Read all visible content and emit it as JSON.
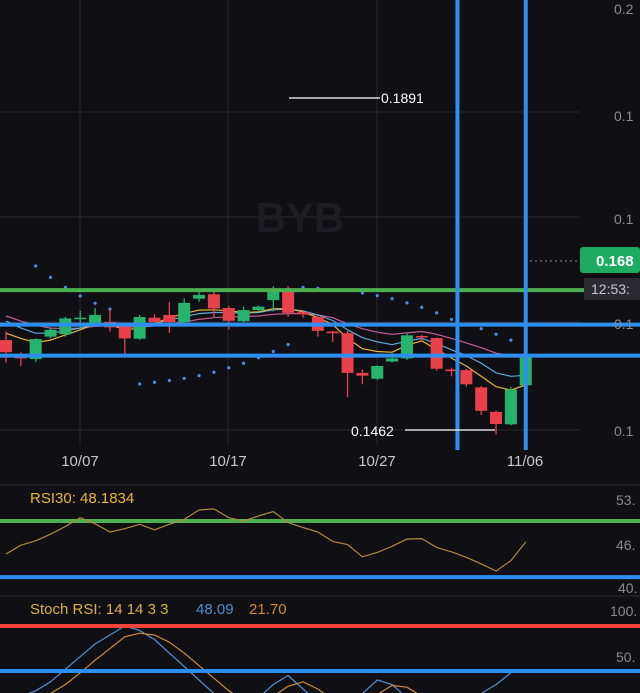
{
  "chart_data": [
    {
      "type": "candlestick",
      "title": "",
      "watermark": "BYB",
      "x_tick_labels": [
        "10/07",
        "10/17",
        "10/27",
        "11/06"
      ],
      "y_tick_labels": [
        "0.2",
        "0.1",
        "0.1",
        "0.1",
        "0.1"
      ],
      "y_range": [
        0.14,
        0.2
      ],
      "price_tag": "0.168",
      "countdown_tag": "12:53:",
      "high_label": "0.1891",
      "low_label": "0.1462",
      "grid": true,
      "candles": [
        {
          "o": 0.1735,
          "h": 0.176,
          "l": 0.167,
          "c": 0.17
        },
        {
          "o": 0.169,
          "h": 0.17,
          "l": 0.166,
          "c": 0.1682
        },
        {
          "o": 0.168,
          "h": 0.174,
          "l": 0.1672,
          "c": 0.1738
        },
        {
          "o": 0.1745,
          "h": 0.177,
          "l": 0.174,
          "c": 0.1765
        },
        {
          "o": 0.1752,
          "h": 0.1802,
          "l": 0.1745,
          "c": 0.1798
        },
        {
          "o": 0.1797,
          "h": 0.182,
          "l": 0.177,
          "c": 0.18
        },
        {
          "o": 0.1781,
          "h": 0.1828,
          "l": 0.1777,
          "c": 0.1808
        },
        {
          "o": 0.1788,
          "h": 0.1824,
          "l": 0.176,
          "c": 0.1772
        },
        {
          "o": 0.1776,
          "h": 0.1784,
          "l": 0.169,
          "c": 0.174
        },
        {
          "o": 0.1739,
          "h": 0.1808,
          "l": 0.1736,
          "c": 0.1802
        },
        {
          "o": 0.18,
          "h": 0.181,
          "l": 0.1777,
          "c": 0.1787
        },
        {
          "o": 0.1808,
          "h": 0.1845,
          "l": 0.1756,
          "c": 0.1787
        },
        {
          "o": 0.1787,
          "h": 0.1856,
          "l": 0.1783,
          "c": 0.1843
        },
        {
          "o": 0.1855,
          "h": 0.1876,
          "l": 0.1846,
          "c": 0.1866
        },
        {
          "o": 0.1868,
          "h": 0.1875,
          "l": 0.1802,
          "c": 0.1827
        },
        {
          "o": 0.1828,
          "h": 0.1834,
          "l": 0.1766,
          "c": 0.1791
        },
        {
          "o": 0.179,
          "h": 0.1832,
          "l": 0.1787,
          "c": 0.1822
        },
        {
          "o": 0.1822,
          "h": 0.1835,
          "l": 0.1815,
          "c": 0.1832
        },
        {
          "o": 0.1851,
          "h": 0.1891,
          "l": 0.1818,
          "c": 0.1883
        },
        {
          "o": 0.1883,
          "h": 0.1891,
          "l": 0.1802,
          "c": 0.1814
        },
        {
          "o": 0.1816,
          "h": 0.1822,
          "l": 0.18,
          "c": 0.181
        },
        {
          "o": 0.1802,
          "h": 0.1808,
          "l": 0.1745,
          "c": 0.1762
        },
        {
          "o": 0.176,
          "h": 0.1762,
          "l": 0.173,
          "c": 0.1755
        },
        {
          "o": 0.1755,
          "h": 0.1762,
          "l": 0.157,
          "c": 0.164
        },
        {
          "o": 0.164,
          "h": 0.165,
          "l": 0.1607,
          "c": 0.1632
        },
        {
          "o": 0.1623,
          "h": 0.1662,
          "l": 0.162,
          "c": 0.166
        },
        {
          "o": 0.1673,
          "h": 0.1697,
          "l": 0.167,
          "c": 0.1682
        },
        {
          "o": 0.1682,
          "h": 0.1757,
          "l": 0.1678,
          "c": 0.1749
        },
        {
          "o": 0.1747,
          "h": 0.175,
          "l": 0.173,
          "c": 0.1745
        },
        {
          "o": 0.1741,
          "h": 0.1743,
          "l": 0.1647,
          "c": 0.1652
        },
        {
          "o": 0.165,
          "h": 0.1655,
          "l": 0.163,
          "c": 0.1645
        },
        {
          "o": 0.1648,
          "h": 0.1652,
          "l": 0.16,
          "c": 0.1607
        },
        {
          "o": 0.1598,
          "h": 0.1602,
          "l": 0.1518,
          "c": 0.153
        },
        {
          "o": 0.1527,
          "h": 0.1531,
          "l": 0.1462,
          "c": 0.1492
        },
        {
          "o": 0.1491,
          "h": 0.16,
          "l": 0.1488,
          "c": 0.1592
        },
        {
          "o": 0.1604,
          "h": 0.169,
          "l": 0.16,
          "c": 0.1685
        }
      ],
      "sar_points": [
        {
          "i": 2,
          "v": 0.195
        },
        {
          "i": 3,
          "v": 0.1917
        },
        {
          "i": 4,
          "v": 0.1888
        },
        {
          "i": 5,
          "v": 0.1863
        },
        {
          "i": 6,
          "v": 0.1842
        },
        {
          "i": 7,
          "v": 0.1825
        },
        {
          "i": 9,
          "v": 0.1608
        },
        {
          "i": 10,
          "v": 0.1613
        },
        {
          "i": 11,
          "v": 0.1618
        },
        {
          "i": 12,
          "v": 0.1624
        },
        {
          "i": 13,
          "v": 0.1632
        },
        {
          "i": 14,
          "v": 0.1642
        },
        {
          "i": 15,
          "v": 0.1655
        },
        {
          "i": 16,
          "v": 0.1668
        },
        {
          "i": 17,
          "v": 0.1684
        },
        {
          "i": 18,
          "v": 0.1702
        },
        {
          "i": 19,
          "v": 0.1722
        },
        {
          "i": 20,
          "v": 0.1888
        },
        {
          "i": 21,
          "v": 0.1885
        },
        {
          "i": 22,
          "v": 0.1881
        },
        {
          "i": 24,
          "v": 0.1872
        },
        {
          "i": 25,
          "v": 0.1864
        },
        {
          "i": 26,
          "v": 0.1855
        },
        {
          "i": 27,
          "v": 0.1843
        },
        {
          "i": 28,
          "v": 0.183
        },
        {
          "i": 29,
          "v": 0.1814
        },
        {
          "i": 30,
          "v": 0.1795
        },
        {
          "i": 31,
          "v": 0.178
        },
        {
          "i": 32,
          "v": 0.1768
        },
        {
          "i": 33,
          "v": 0.1752
        },
        {
          "i": 34,
          "v": 0.1735
        },
        {
          "i": 35,
          "v": 0.1718
        }
      ],
      "ma_fast": [
        0.1755,
        0.174,
        0.1728,
        0.1735,
        0.175,
        0.1765,
        0.1782,
        0.178,
        0.1765,
        0.177,
        0.1783,
        0.18,
        0.1812,
        0.1822,
        0.1823,
        0.182,
        0.1815,
        0.1817,
        0.1826,
        0.1826,
        0.1817,
        0.18,
        0.178,
        0.174,
        0.171,
        0.1702,
        0.17,
        0.172,
        0.1733,
        0.1708,
        0.1683,
        0.166,
        0.163,
        0.16,
        0.159,
        0.1605
      ],
      "ma_slow": [
        0.1805,
        0.179,
        0.1778,
        0.177,
        0.1768,
        0.177,
        0.1775,
        0.1777,
        0.1773,
        0.1773,
        0.1776,
        0.1782,
        0.1788,
        0.1795,
        0.18,
        0.1803,
        0.1803,
        0.1805,
        0.181,
        0.1812,
        0.1812,
        0.1808,
        0.18,
        0.1782,
        0.1768,
        0.1758,
        0.1752,
        0.1756,
        0.176,
        0.1752,
        0.174,
        0.1727,
        0.1713,
        0.1697,
        0.169,
        0.169
      ],
      "ma_mid": [
        0.179,
        0.177,
        0.1755,
        0.1755,
        0.1762,
        0.177,
        0.178,
        0.1782,
        0.1775,
        0.1777,
        0.1783,
        0.1793,
        0.1803,
        0.1812,
        0.1815,
        0.1815,
        0.1813,
        0.1815,
        0.1823,
        0.1825,
        0.182,
        0.1808,
        0.1792,
        0.1765,
        0.1742,
        0.173,
        0.1722,
        0.1732,
        0.174,
        0.1725,
        0.1707,
        0.169,
        0.1668,
        0.164,
        0.163,
        0.1633
      ],
      "hlines": [
        {
          "price": 0.188,
          "color": "#4caf50"
        },
        {
          "price": 0.178,
          "color": "#2e8ff2"
        },
        {
          "price": 0.169,
          "color": "#2e8ff2"
        }
      ],
      "vlines": [
        {
          "index": 30.4,
          "color": "#2e8ff2"
        },
        {
          "index": 35.0,
          "color": "#2e8ff2"
        }
      ]
    },
    {
      "type": "line",
      "label": "RSI30: 48.1834",
      "y_tick_labels": [
        "53.",
        "46.",
        "40."
      ],
      "values": [
        46.0,
        47.6,
        48.4,
        49.6,
        51.0,
        52.6,
        51.5,
        50.0,
        50.6,
        51.4,
        50.4,
        51.4,
        52.3,
        54.0,
        54.2,
        52.6,
        52.0,
        52.9,
        53.7,
        51.7,
        50.8,
        50.0,
        48.3,
        47.7,
        45.5,
        46.3,
        47.4,
        48.7,
        48.8,
        47.2,
        46.4,
        45.4,
        44.2,
        42.9,
        44.8,
        48.2
      ],
      "hlines": [
        {
          "value": 52.0,
          "color": "#4caf50"
        },
        {
          "value": 41.8,
          "color": "#2e8ff2"
        }
      ]
    },
    {
      "type": "line",
      "label_prefix": "Stoch RSI: 14 14 3 3",
      "label_k": "48.09",
      "label_d": "21.70",
      "y_tick_labels": [
        "100.",
        "50."
      ],
      "k_values": [
        15,
        22,
        28,
        38,
        52,
        66,
        80,
        90,
        100,
        95,
        85,
        70,
        55,
        40,
        25,
        15,
        10,
        20,
        35,
        45,
        30,
        15,
        5,
        10,
        25,
        40,
        35,
        20,
        10,
        5,
        8,
        15,
        25,
        35,
        48
      ],
      "d_values": [
        8,
        12,
        18,
        25,
        35,
        48,
        62,
        75,
        88,
        92,
        90,
        82,
        70,
        56,
        42,
        28,
        18,
        14,
        22,
        33,
        38,
        30,
        18,
        10,
        12,
        24,
        34,
        32,
        22,
        12,
        8,
        10,
        15,
        18,
        21.7
      ],
      "hlines": [
        {
          "value": 100,
          "color": "#f4433a"
        },
        {
          "value": 50,
          "color": "#2e8ff2"
        },
        {
          "value": 20,
          "color": "#ff9a1f"
        }
      ]
    }
  ],
  "colors": {
    "background": "#101014",
    "up": "#26b36b",
    "down": "#e8414c",
    "grid": "#26262c",
    "text": "#c8c8cc",
    "axis_text": "#8a8a90",
    "sar": "#4c8fe0",
    "ma_fast": "#e9b43a",
    "ma_slow": "#c65a9a",
    "ma_mid": "#5fa8d8",
    "rsi_line": "#b08a3a",
    "stoch_k": "#4f8fd0",
    "stoch_d": "#d08a3a",
    "rsi_label": "#e9b43a",
    "stoch_label": "#d8b04a",
    "price_tag_bg": "#1faa62"
  }
}
